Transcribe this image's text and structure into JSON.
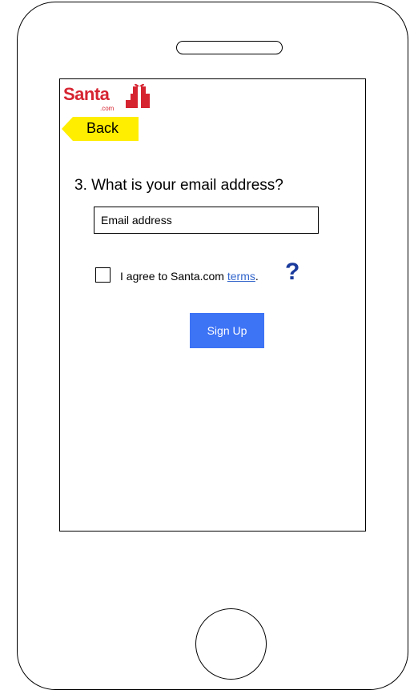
{
  "logo": {
    "brand": "Santa",
    "suffix": ".com"
  },
  "nav": {
    "back_label": "Back"
  },
  "form": {
    "question": "3. What is your email address?",
    "email_placeholder": "Email address",
    "email_value": "",
    "agree_prefix": "I agree to Santa.com ",
    "terms_label": "terms",
    "agree_suffix": ".",
    "help_glyph": "?",
    "signup_label": "Sign Up",
    "agree_checked": false
  },
  "colors": {
    "brand_red": "#d62431",
    "back_yellow": "#ffee00",
    "link_blue": "#3366cc",
    "help_blue": "#1a3a9c",
    "button_blue": "#3d73f5"
  },
  "icons": {
    "logo": "gift-stack-icon",
    "help": "question-mark-icon",
    "back": "back-arrow-tag"
  }
}
